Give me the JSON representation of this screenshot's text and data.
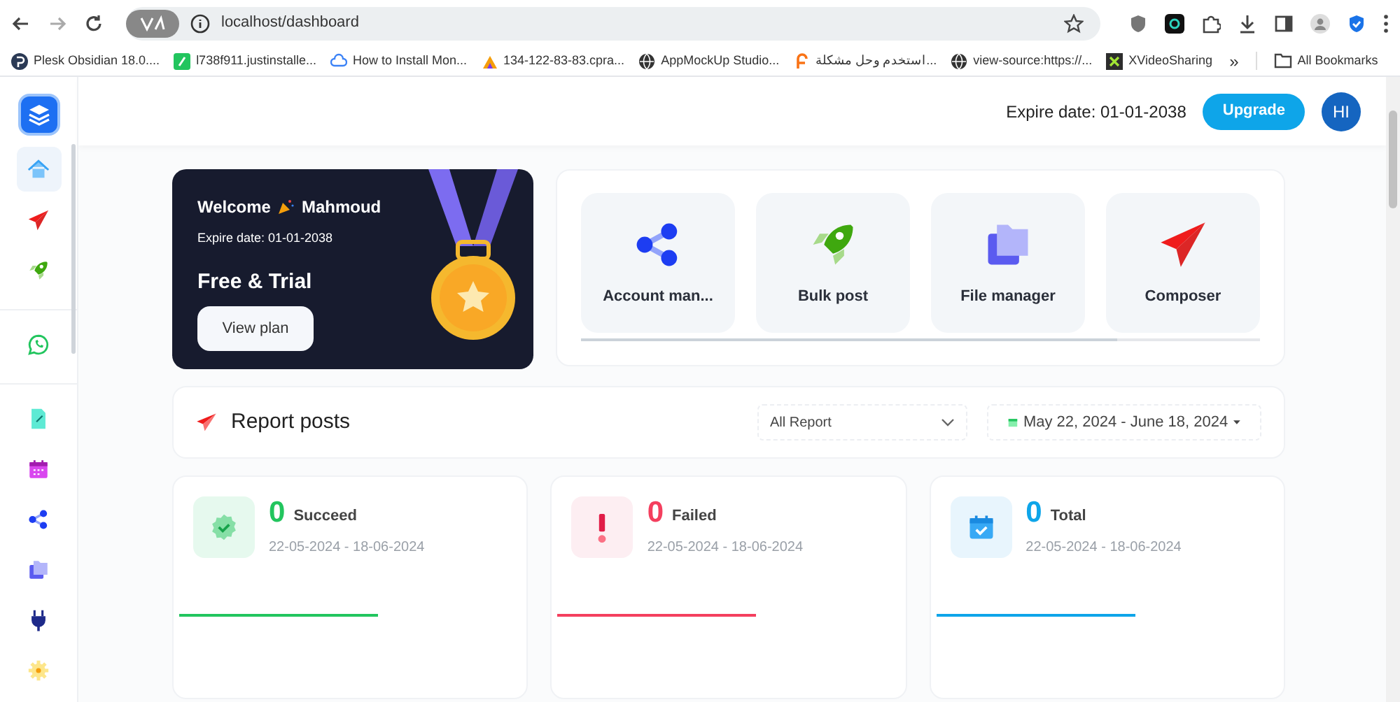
{
  "browser": {
    "url": "localhost/dashboard",
    "bookmarks": [
      {
        "kind": "plesk",
        "label": "Plesk Obsidian 18.0...."
      },
      {
        "kind": "green",
        "label": "l738f911.justinstalle..."
      },
      {
        "kind": "cloud",
        "label": "How to Install Mon..."
      },
      {
        "kind": "cpanel",
        "label": "134-122-83-83.cpra..."
      },
      {
        "kind": "globe",
        "label": "AppMockUp Studio..."
      },
      {
        "kind": "orange",
        "label": "استخدم وحل مشكلة..."
      },
      {
        "kind": "globe",
        "label": "view-source:https://..."
      },
      {
        "kind": "xv",
        "label": "XVideoSharing"
      }
    ],
    "more": "»",
    "all_bookmarks": "All Bookmarks"
  },
  "sidebar": {
    "groups": [
      [
        {
          "kind": "home",
          "selected": true
        },
        {
          "kind": "send",
          "selected": false
        },
        {
          "kind": "rocket",
          "selected": false
        }
      ],
      [
        {
          "kind": "whatsapp",
          "selected": false
        }
      ],
      [
        {
          "kind": "file",
          "selected": false
        },
        {
          "kind": "calendar",
          "selected": false
        },
        {
          "kind": "share",
          "selected": false
        },
        {
          "kind": "folder",
          "selected": false
        },
        {
          "kind": "plug",
          "selected": false
        },
        {
          "kind": "gear",
          "selected": false
        }
      ]
    ]
  },
  "header": {
    "expire": "Expire date: 01-01-2038",
    "upgrade": "Upgrade",
    "avatar": "HI"
  },
  "welcome": {
    "greeting": "Welcome",
    "name": "Mahmoud",
    "expire": "Expire date: 01-01-2038",
    "plan": "Free & Trial",
    "button": "View plan"
  },
  "apps": [
    {
      "kind": "share",
      "label": "Account man..."
    },
    {
      "kind": "rocket",
      "label": "Bulk post"
    },
    {
      "kind": "folder",
      "label": "File manager"
    },
    {
      "kind": "send",
      "label": "Composer"
    }
  ],
  "report": {
    "title": "Report posts",
    "filter": "All Report",
    "date_range": "May 22, 2024 - June 18, 2024"
  },
  "stats": [
    {
      "kind": "succeed",
      "value": "0",
      "label": "Succeed",
      "range": "22-05-2024 - 18-06-2024",
      "color": "#22c55e"
    },
    {
      "kind": "failed",
      "value": "0",
      "label": "Failed",
      "range": "22-05-2024 - 18-06-2024",
      "color": "#f43f5e"
    },
    {
      "kind": "total",
      "value": "0",
      "label": "Total",
      "range": "22-05-2024 - 18-06-2024",
      "color": "#0ea5e9"
    }
  ]
}
